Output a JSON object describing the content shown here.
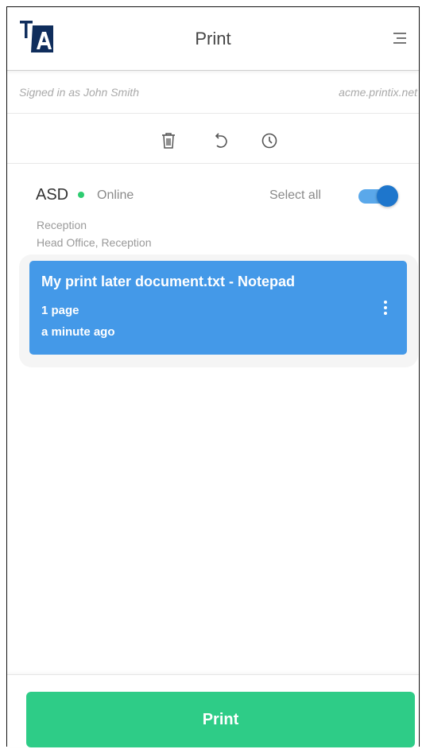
{
  "header": {
    "logo_letters": "TA",
    "title": "Print"
  },
  "account": {
    "signed_in_text": "Signed in as John Smith",
    "domain": "acme.printix.net"
  },
  "toolbar": {
    "icons": [
      "trash-icon",
      "undo-icon",
      "clock-icon"
    ]
  },
  "printer": {
    "name": "ASD",
    "status": "Online",
    "status_color": "#2ecc71",
    "select_all_label": "Select all",
    "select_all_on": true,
    "location_line1": "Reception",
    "location_line2": "Head Office, Reception"
  },
  "jobs": [
    {
      "title": "My print later document.txt - Notepad",
      "pages": "1 page",
      "time": "a minute ago"
    }
  ],
  "footer": {
    "print_label": "Print"
  },
  "colors": {
    "job_card": "#4499e8",
    "print_button": "#2ecc87",
    "toggle_knob": "#1e76cc"
  }
}
